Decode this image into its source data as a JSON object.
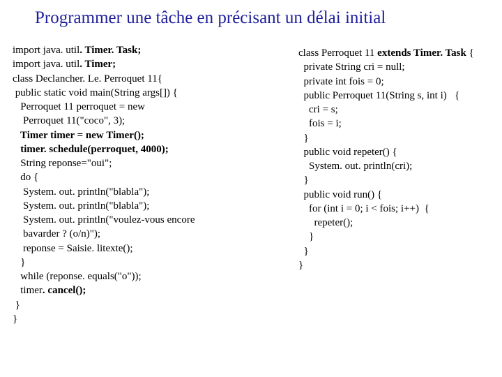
{
  "title": "Programmer une tâche en précisant un délai initial",
  "left": {
    "l1a": "import java. util",
    "l1b": ". Timer. Task;",
    "l2a": "import java. util",
    "l2b": ". Timer;",
    "l3": "class Declancher. Le. Perroquet 11{",
    "l4": " public static void main(String args[]) {",
    "l5": "   Perroquet 11 perroquet = new",
    "l6": "    Perroquet 11(\"coco\", 3);",
    "l7": "   Timer timer = new Timer();",
    "l8": "   timer. schedule(perroquet, 4000);",
    "l9": "   String reponse=\"oui\";",
    "l10": "   do {",
    "l11": "    System. out. println(\"blabla\");",
    "l12": "    System. out. println(\"blabla\");",
    "l13": "    System. out. println(\"voulez-vous encore",
    "l14": "    bavarder ? (o/n)\");",
    "l15": "    reponse = Saisie. litexte();",
    "l16": "   }",
    "l17": "   while (reponse. equals(\"o\"));",
    "l18a": "   timer",
    "l18b": ". cancel();",
    "l19": " }",
    "l20": "}"
  },
  "right": {
    "l1a": "class Perroquet 11 ",
    "l1b": "extends Timer. Task",
    "l1c": " {",
    "l2": "  private String cri = null;",
    "l3": "  private int fois = 0;",
    "l4": "  public Perroquet 11(String s, int i)   {",
    "l5": "    cri = s;",
    "l6": "    fois = i;",
    "l7": "  }",
    "l8": "  public void repeter() {",
    "l9": "    System. out. println(cri);",
    "l10": "  }",
    "l11": "  public void run() {",
    "l12": "    for (int i = 0; i < fois; i++)  {",
    "l13": "      repeter();",
    "l14": "    }",
    "l15": "  }",
    "l16": "}"
  }
}
